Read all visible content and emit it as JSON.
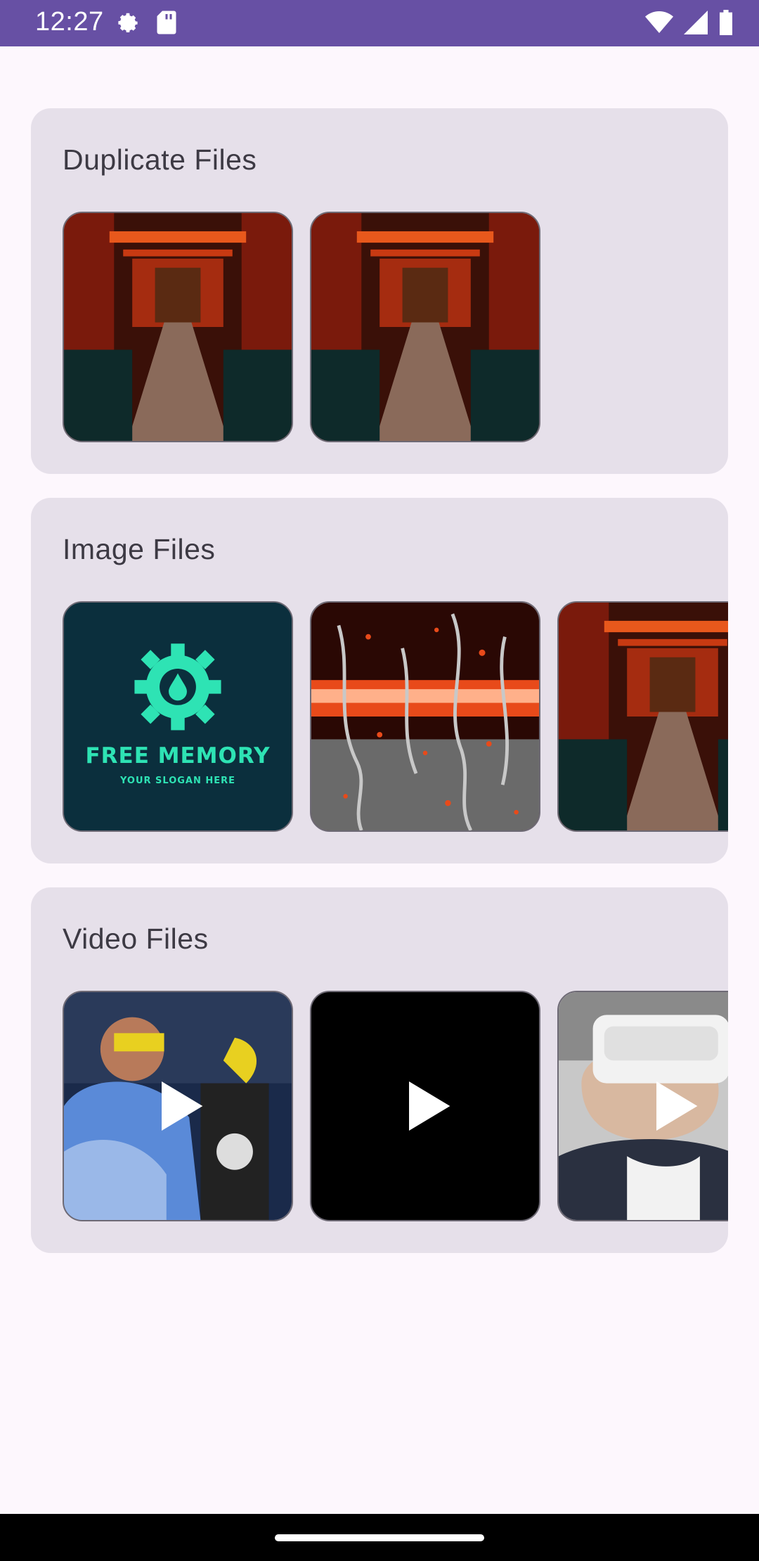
{
  "status_bar": {
    "time": "12:27",
    "icons": [
      "settings-icon",
      "sd-card-icon",
      "wifi-icon",
      "signal-icon",
      "battery-icon"
    ]
  },
  "sections": [
    {
      "title": "Duplicate Files",
      "thumbs": [
        "torii-path-image",
        "torii-path-image"
      ]
    },
    {
      "title": "Image Files",
      "thumbs": [
        "free-memory-logo-image",
        "rain-drops-image",
        "torii-path-image"
      ]
    },
    {
      "title": "Video Files",
      "thumbs": [
        "lab-scientist-video",
        "black-video",
        "vr-headset-video"
      ]
    }
  ],
  "logo": {
    "title": "FREE MEMORY",
    "slogan": "YOUR SLOGAN HERE"
  },
  "colors": {
    "accent": "#6750a4",
    "card": "#e6e0ea",
    "background": "#fdf7fd",
    "logo_teal": "#2ee3b4",
    "logo_bg": "#0b2f3d"
  }
}
